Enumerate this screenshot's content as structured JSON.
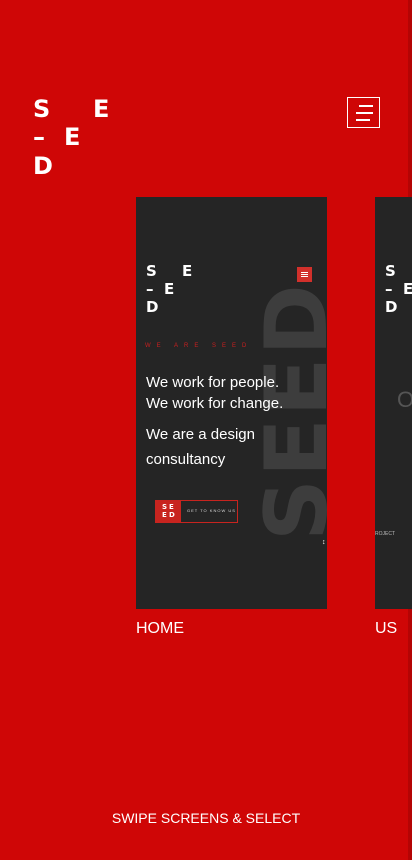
{
  "brand": {
    "letters": [
      "S",
      "E",
      "–",
      "E",
      "D"
    ]
  },
  "header": {
    "menu_icon": "hamburger-menu-icon"
  },
  "cards": {
    "home": {
      "label": "HOME",
      "mini_logo": [
        "S",
        "E",
        "–",
        "E",
        "D"
      ],
      "background_word": "SEED",
      "kicker": "WE ARE SEED",
      "headline_line1": "We work for people.",
      "headline_line2": "We work for change.",
      "subline": "We are a design consultancy",
      "cta_logo": [
        "S",
        "E",
        "E",
        "D"
      ],
      "cta_label": "GET TO KNOW US",
      "scroll_arrows": "↕"
    },
    "us": {
      "label": "US",
      "mini_logo": [
        "S",
        "E",
        "–",
        "E",
        "D"
      ],
      "partial_text": "O",
      "partial_caption": "ROJECT"
    }
  },
  "footer": {
    "swipe_hint": "SWIPE SCREENS & SELECT"
  },
  "colors": {
    "background": "#cf0606",
    "card": "#252525",
    "accent": "#c8241f",
    "text": "#ffffff"
  }
}
